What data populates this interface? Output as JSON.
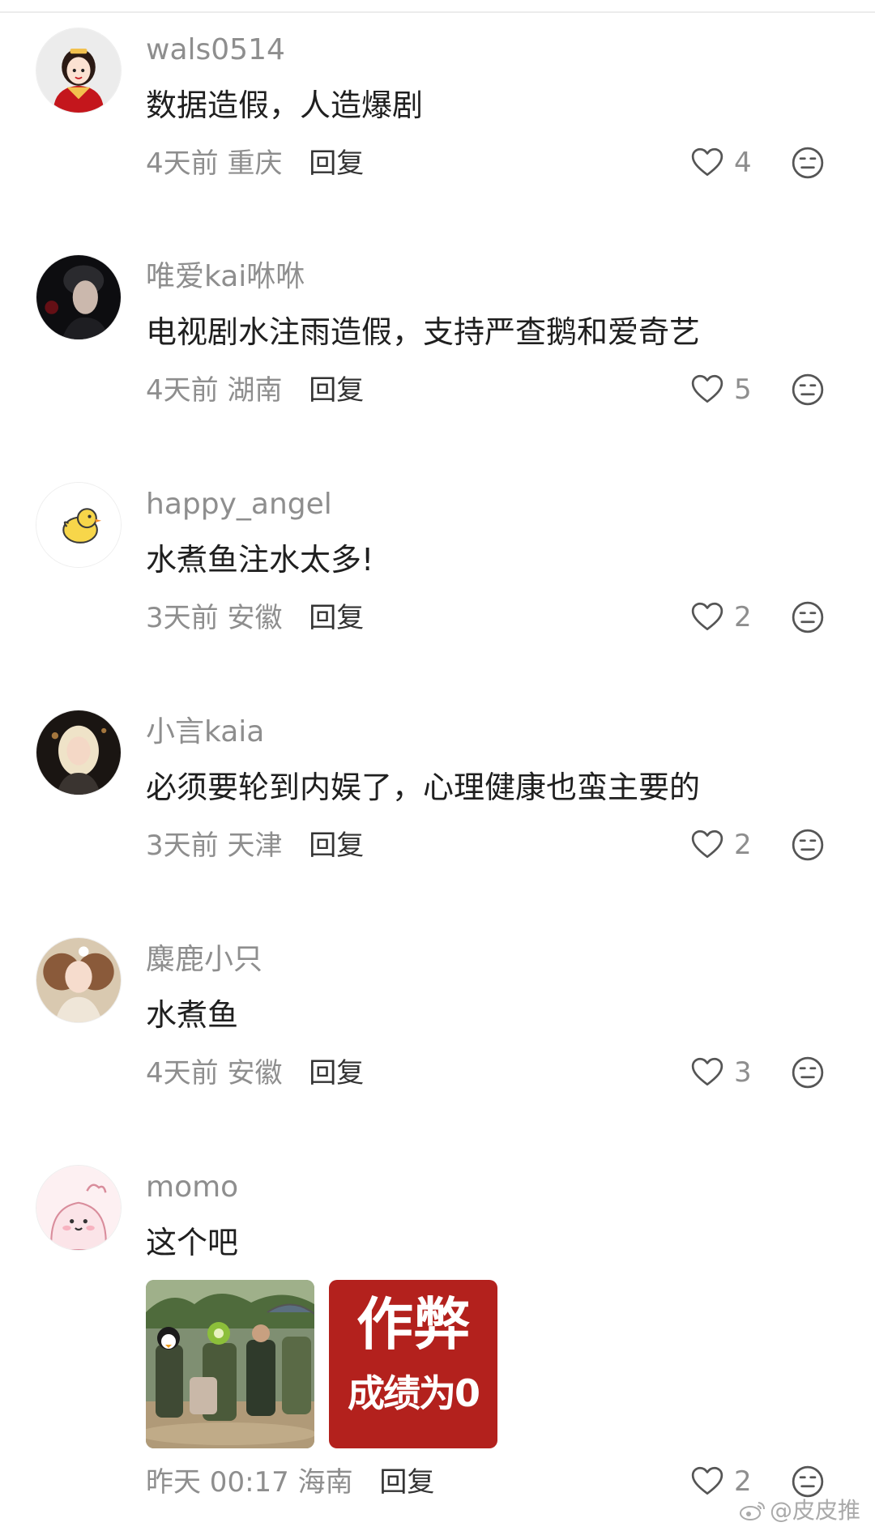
{
  "comments": [
    {
      "username": "wals0514",
      "text": "数据造假，人造爆剧",
      "time": "4天前",
      "location": "重庆",
      "reply_label": "回复",
      "likes": "4"
    },
    {
      "username": "唯爱kai咻咻",
      "text": "电视剧水注雨造假，支持严查鹅和爱奇艺",
      "time": "4天前",
      "location": "湖南",
      "reply_label": "回复",
      "likes": "5"
    },
    {
      "username": "happy_angel",
      "text": "水煮鱼注水太多!",
      "time": "3天前",
      "location": "安徽",
      "reply_label": "回复",
      "likes": "2"
    },
    {
      "username": "小言kaia",
      "text": "必须要轮到内娱了，心理健康也蛮主要的",
      "time": "3天前",
      "location": "天津",
      "reply_label": "回复",
      "likes": "2"
    },
    {
      "username": "麋鹿小只",
      "text": "水煮鱼",
      "time": "4天前",
      "location": "安徽",
      "reply_label": "回复",
      "likes": "3"
    },
    {
      "username": "momo",
      "text": "这个吧",
      "time": "昨天 00:17",
      "location": "海南",
      "reply_label": "回复",
      "likes": "2",
      "images": [
        {
          "kind": "photo"
        },
        {
          "kind": "text-card",
          "line1": "作弊",
          "line2": "成绩为0"
        }
      ]
    }
  ],
  "watermark": {
    "text": "@皮皮推"
  },
  "icons": {
    "like": "heart-outline-icon",
    "dislike": "neutral-face-icon",
    "watermark": "weibo-logo-icon"
  },
  "colors": {
    "secondary_text": "#8e8e8e",
    "primary_text": "#1f1f1f",
    "card_red": "#b3211d"
  }
}
